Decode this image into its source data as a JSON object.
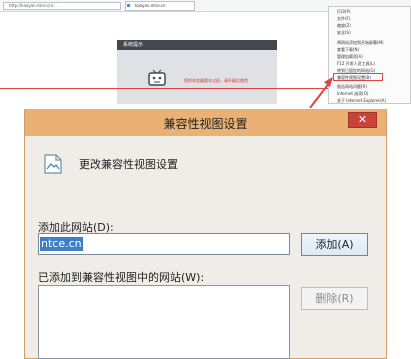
{
  "browser": {
    "address": "http://kaoyan.ntce.cn/...",
    "tab_title": "kaoyan.ntce.cn",
    "notice_title": "系统提示",
    "notice_message": "您的浏览器版本过低，请升级后使用",
    "menu_items": [
      "打印(P)",
      "文件(F)",
      "缩放(Z)",
      "安全(S)",
      "将网站添加到开始屏幕(M)",
      "查看下载(N)",
      "管理加载项(A)",
      "F12 开发人员工具(L)",
      "转到已固定的网站(G)",
      "兼容性视图设置(B)",
      "报告网站问题(R)",
      "Internet 选项(O)",
      "关于 Internet Explorer(A)"
    ]
  },
  "dialog": {
    "title": "兼容性视图设置",
    "close_label": "✕",
    "heading": "更改兼容性视图设置",
    "add_site_label": "添加此网站(D):",
    "site_value": "ntce.cn",
    "add_button": "添加(A)",
    "list_label": "已添加到兼容性视图中的网站(W):",
    "remove_button": "删除(R)"
  },
  "colors": {
    "titlebar": "#e9b274",
    "close": "#c9433a",
    "selection": "#3f7fc8",
    "highlight_red": "#e04343"
  }
}
